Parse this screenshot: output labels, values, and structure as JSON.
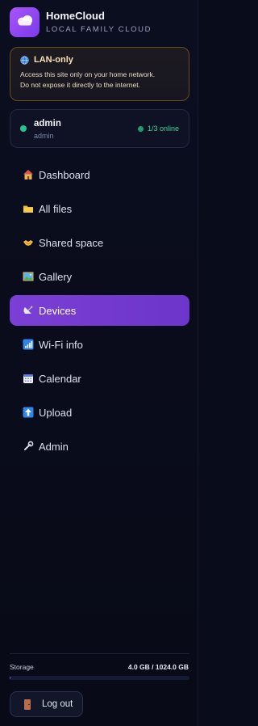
{
  "brand": {
    "title": "HomeCloud",
    "subtitle": "LOCAL FAMILY CLOUD",
    "icon": "cloud-icon",
    "accent": "#8b5cf6"
  },
  "lan_notice": {
    "title": "LAN-only",
    "icon": "globe-icon",
    "line1": "Access this site only on your home network.",
    "line2": "Do not expose it directly to the internet."
  },
  "user": {
    "name": "admin",
    "role": "admin",
    "online": "1/3 online",
    "status_color": "#22c58b"
  },
  "nav": {
    "items": [
      {
        "label": "Dashboard",
        "icon": "house-icon",
        "active": false
      },
      {
        "label": "All files",
        "icon": "folder-icon",
        "active": false
      },
      {
        "label": "Shared space",
        "icon": "handshake-icon",
        "active": false
      },
      {
        "label": "Gallery",
        "icon": "picture-icon",
        "active": false
      },
      {
        "label": "Devices",
        "icon": "satellite-icon",
        "active": true
      },
      {
        "label": "Wi-Fi info",
        "icon": "signal-bars-icon",
        "active": false
      },
      {
        "label": "Calendar",
        "icon": "calendar-icon",
        "active": false
      },
      {
        "label": "Upload",
        "icon": "upload-arrow-icon",
        "active": false
      },
      {
        "label": "Admin",
        "icon": "wrench-icon",
        "active": false
      }
    ]
  },
  "storage": {
    "label": "Storage",
    "value": "4.0 GB / 1024.0 GB",
    "used_fraction": 0.0039
  },
  "logout": {
    "label": "Log out",
    "icon": "door-icon"
  }
}
